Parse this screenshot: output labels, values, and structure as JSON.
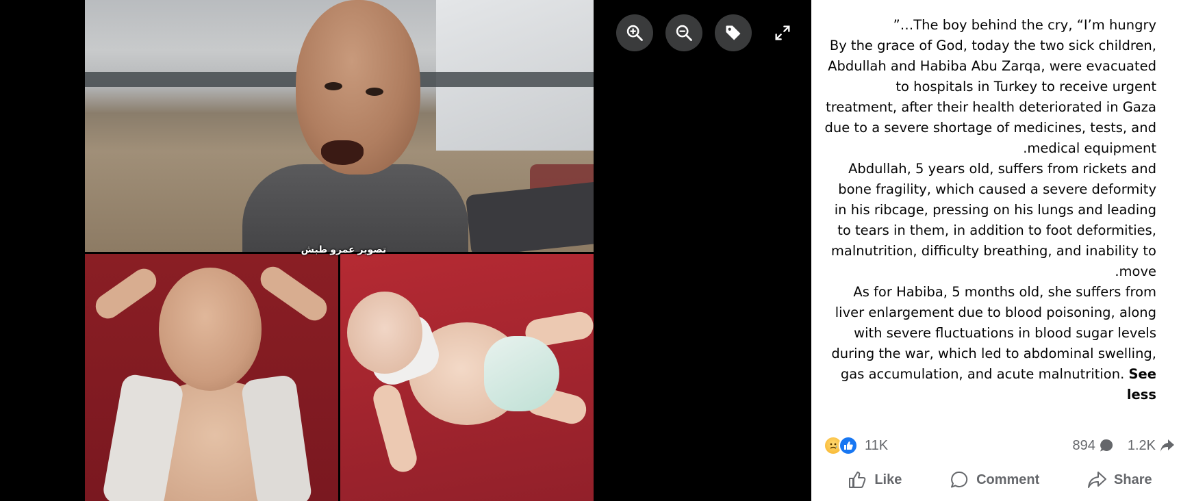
{
  "viewer": {
    "caption_arabic": "تصوير عمرو طبش",
    "controls": {
      "zoom_in": "zoom-in-icon",
      "zoom_out": "zoom-out-icon",
      "tag": "tag-icon",
      "fullscreen": "expand-icon"
    }
  },
  "post": {
    "paragraphs": [
      "The boy behind the cry, “I’m hungry…”",
      "By the grace of God, today the two sick children, Abdullah and Habiba Abu Zarqa, were evacuated to hospitals in Turkey to receive urgent treatment, after their health deteriorated in Gaza due to a severe shortage of medicines, tests, and medical equipment.",
      "Abdullah, 5 years old, suffers from rickets and bone fragility, which caused a severe deformity in his ribcage, pressing on his lungs and leading to tears in them, in addition to foot deformities, malnutrition, difficulty breathing, and inability to move.",
      "As for Habiba, 5 months old, she suffers from liver enlargement due to blood poisoning, along with severe fluctuations in blood sugar levels during the war, which led to abdominal swelling, gas accumulation, and acute malnutrition."
    ],
    "see_less": "See less"
  },
  "stats": {
    "reactions_count": "11K",
    "comments_count": "894",
    "shares_count": "1.2K"
  },
  "actions": {
    "like": "Like",
    "comment": "Comment",
    "share": "Share"
  },
  "colors": {
    "like_blue": "#1877f2",
    "panel_bg": "#ffffff",
    "viewer_bg": "#000000",
    "secondary_text": "#65676b"
  }
}
